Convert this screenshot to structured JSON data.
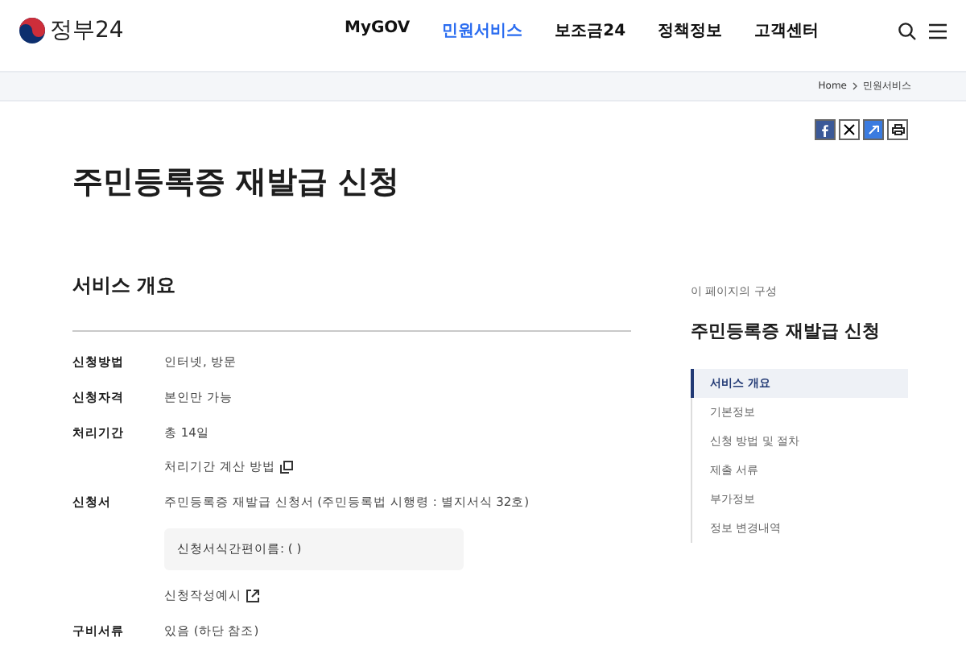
{
  "header": {
    "logo": "정부24",
    "nav": [
      {
        "label": "MyGOV",
        "selected": false
      },
      {
        "label": "민원서비스",
        "selected": true
      },
      {
        "label": "보조금24",
        "selected": false
      },
      {
        "label": "정책정보",
        "selected": false
      },
      {
        "label": "고객센터",
        "selected": false
      }
    ]
  },
  "breadcrumb": [
    "Home",
    "민원서비스"
  ],
  "title": "주민등록증 재발급 신청",
  "section": "서비스 개요",
  "rows": [
    {
      "label": "신청방법",
      "lines": [
        {
          "kind": "text",
          "text": "인터넷, 방문"
        }
      ]
    },
    {
      "label": "신청자격",
      "lines": [
        {
          "kind": "text",
          "text": "본인만 가능"
        }
      ]
    },
    {
      "label": "처리기간",
      "lines": [
        {
          "kind": "text",
          "text": "총 14일"
        },
        {
          "kind": "copy-link",
          "text": "처리기간 계산 방법"
        }
      ]
    },
    {
      "label": "신청서",
      "lines": [
        {
          "kind": "text",
          "text": "주민등록증 재발급 신청서 (주민등록법 시행령 : 별지서식 32호)"
        },
        {
          "kind": "box",
          "text": "신청서식간편이름: ( )"
        },
        {
          "kind": "external-link",
          "text": "신청작성예시"
        }
      ]
    },
    {
      "label": "구비서류",
      "lines": [
        {
          "kind": "text",
          "text": "있음 (하단 참조)"
        }
      ]
    }
  ],
  "toc": {
    "caption": "이 페이지의 구성",
    "title": "주민등록증 재발급 신청",
    "items": [
      {
        "label": "서비스 개요",
        "selected": true
      },
      {
        "label": "기본정보",
        "selected": false
      },
      {
        "label": "신청 방법 및 절차",
        "selected": false
      },
      {
        "label": "제출 서류",
        "selected": false
      },
      {
        "label": "부가정보",
        "selected": false
      },
      {
        "label": "정보 변경내역",
        "selected": false
      }
    ]
  }
}
